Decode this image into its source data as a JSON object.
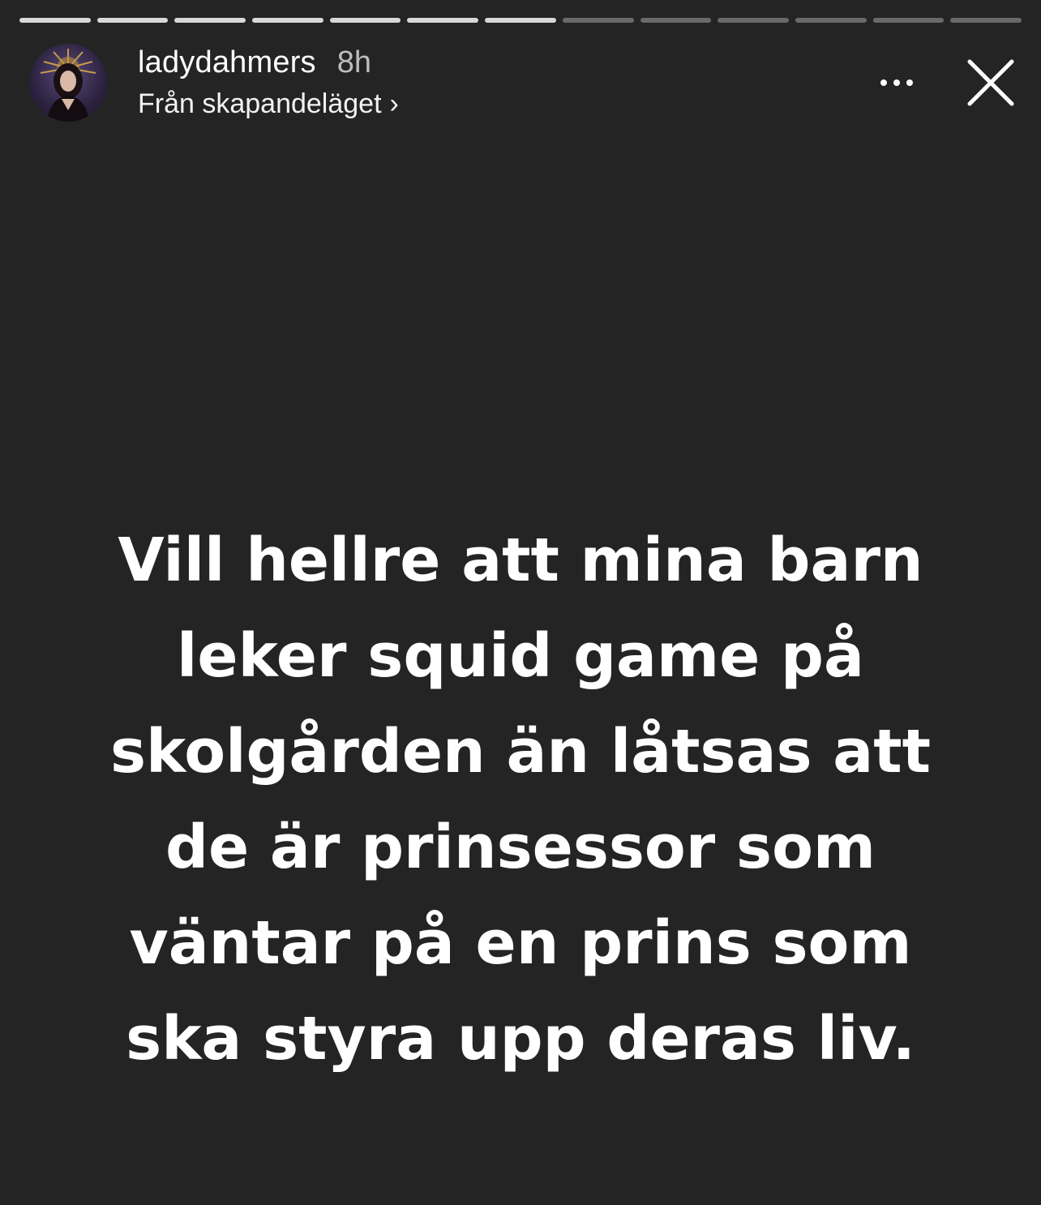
{
  "story": {
    "segments_total": 13,
    "segments_viewed": 7,
    "colors": {
      "background": "#242424",
      "progress_done": "#d8d8d8",
      "progress_pending": "#6a6a6a",
      "text": "#ffffff"
    }
  },
  "header": {
    "avatar_icon": "profile-avatar",
    "username": "ladydahmers",
    "time_ago": "8h",
    "source_label": "Från skapandeläget",
    "source_chevron": "›",
    "more_icon": "more-horizontal-icon",
    "close_icon": "close-icon"
  },
  "caption": {
    "lines": [
      "Vill hellre att mina barn",
      "leker squid game på",
      "skolgården än låtsas att",
      "de är prinsessor som",
      "väntar på en prins som",
      "ska styra upp deras liv."
    ]
  }
}
